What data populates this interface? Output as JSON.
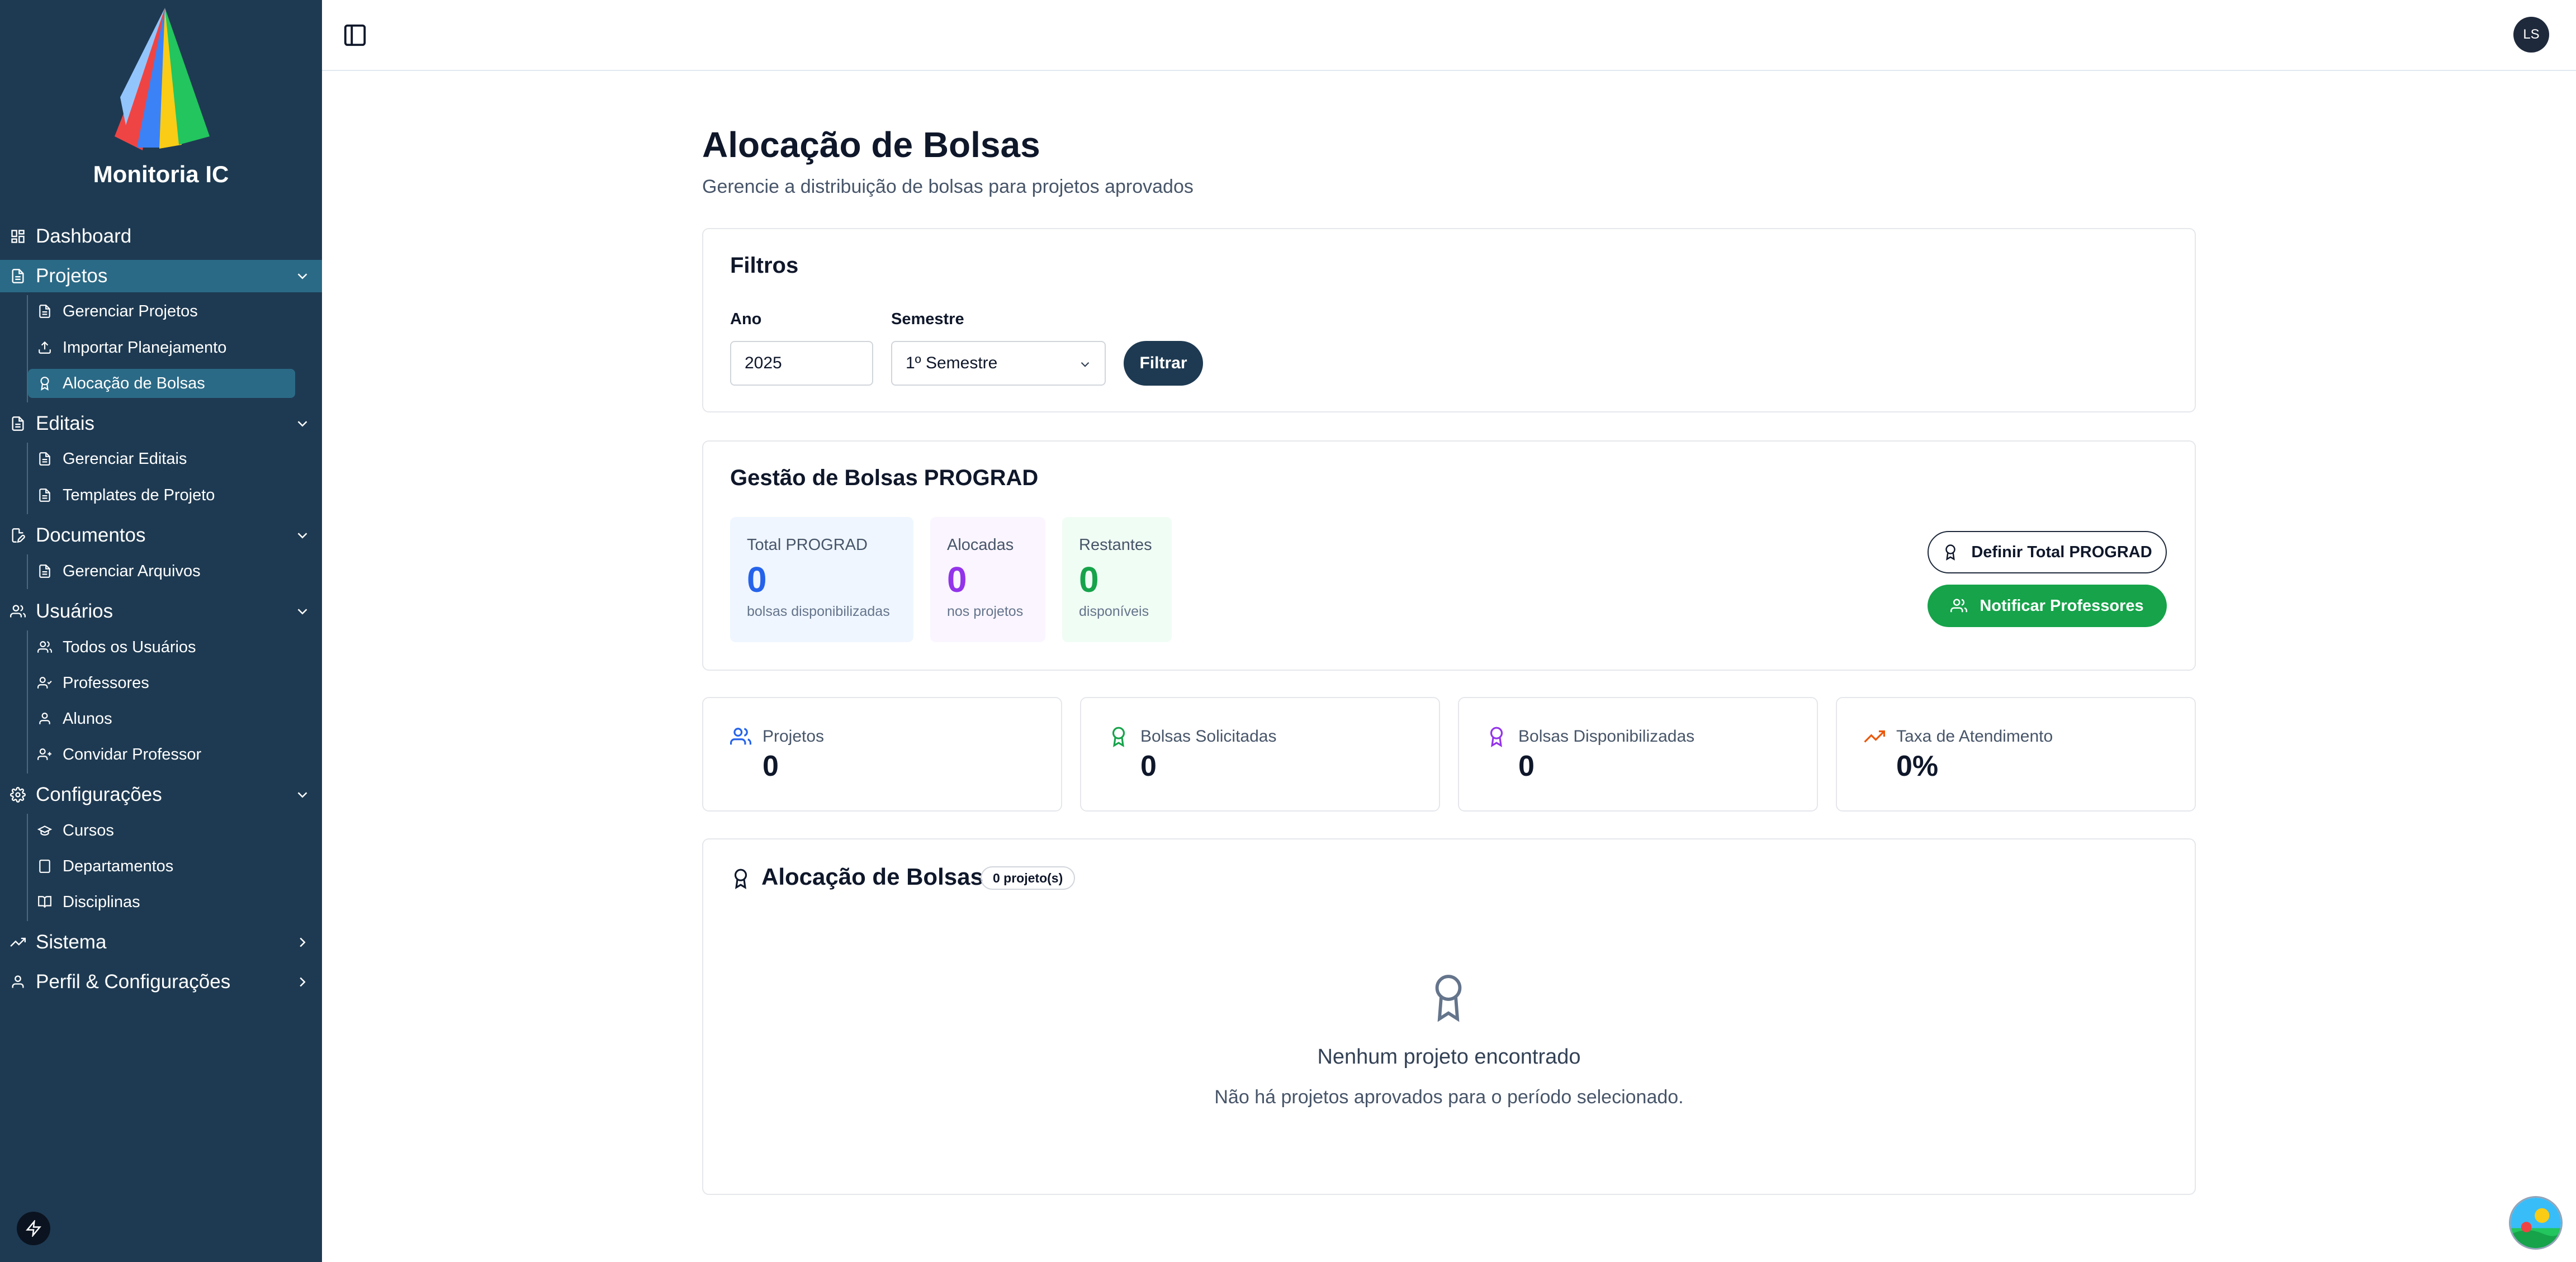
{
  "app": {
    "name": "Monitoria IC",
    "user_initials": "LS"
  },
  "sidebar": {
    "dashboard": "Dashboard",
    "projetos": {
      "label": "Projetos",
      "items": [
        "Gerenciar Projetos",
        "Importar Planejamento",
        "Alocação de Bolsas"
      ]
    },
    "editais": {
      "label": "Editais",
      "items": [
        "Gerenciar Editais",
        "Templates de Projeto"
      ]
    },
    "documentos": {
      "label": "Documentos",
      "items": [
        "Gerenciar Arquivos"
      ]
    },
    "usuarios": {
      "label": "Usuários",
      "items": [
        "Todos os Usuários",
        "Professores",
        "Alunos",
        "Convidar Professor"
      ]
    },
    "configuracoes": {
      "label": "Configurações",
      "items": [
        "Cursos",
        "Departamentos",
        "Disciplinas"
      ]
    },
    "sistema": "Sistema",
    "perfil": "Perfil & Configurações"
  },
  "page": {
    "title": "Alocação de Bolsas",
    "subtitle": "Gerencie a distribuição de bolsas para projetos aprovados"
  },
  "filters": {
    "title": "Filtros",
    "year_label": "Ano",
    "year_value": "2025",
    "semester_label": "Semestre",
    "semester_value": "1º Semestre",
    "filter_button": "Filtrar"
  },
  "prograd": {
    "title": "Gestão de Bolsas PROGRAD",
    "total": {
      "label": "Total PROGRAD",
      "value": "0",
      "note": "bolsas disponibilizadas"
    },
    "alocadas": {
      "label": "Alocadas",
      "value": "0",
      "note": "nos projetos"
    },
    "restantes": {
      "label": "Restantes",
      "value": "0",
      "note": "disponíveis"
    },
    "define_button": "Definir Total PROGRAD",
    "notify_button": "Notificar Professores"
  },
  "metrics": [
    {
      "label": "Projetos",
      "value": "0"
    },
    {
      "label": "Bolsas Solicitadas",
      "value": "0"
    },
    {
      "label": "Bolsas Disponibilizadas",
      "value": "0"
    },
    {
      "label": "Taxa de Atendimento",
      "value": "0%"
    }
  ],
  "allocation": {
    "title": "Alocação de Bolsas",
    "badge": "0 projeto(s)",
    "empty_title": "Nenhum projeto encontrado",
    "empty_text": "Não há projetos aprovados para o período selecionado."
  },
  "colors": {
    "sidebar_bg": "#1e3a52",
    "active_item": "#2b6a86",
    "primary_button": "#1e3a52",
    "success": "#16a34a",
    "total_accent": "#2563eb",
    "allocated_accent": "#9333ea",
    "remaining_accent": "#16a34a"
  }
}
